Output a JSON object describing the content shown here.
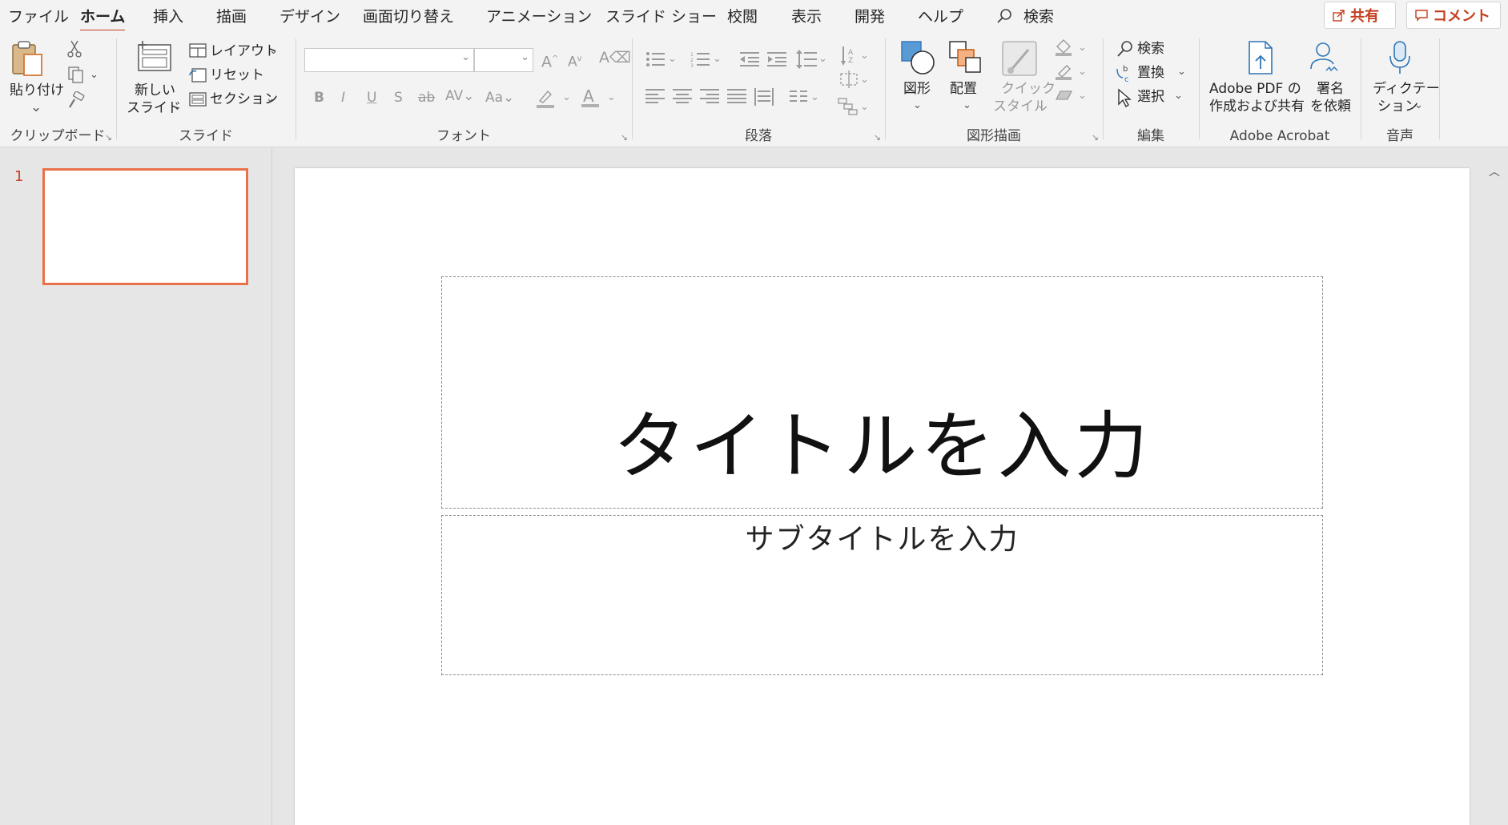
{
  "menu": {
    "tabs": [
      "ファイル",
      "ホーム",
      "挿入",
      "描画",
      "デザイン",
      "画面切り替え",
      "アニメーション",
      "スライド ショー",
      "校閲",
      "表示",
      "開発",
      "ヘルプ"
    ],
    "search": "検索",
    "share": "共有",
    "comment": "コメント"
  },
  "ribbon": {
    "clipboard": {
      "paste": "貼り付け",
      "label": "クリップボード"
    },
    "slides": {
      "new_slide_1": "新しい",
      "new_slide_2": "スライド",
      "layout": "レイアウト",
      "reset": "リセット",
      "section": "セクション",
      "label": "スライド"
    },
    "font": {
      "label": "フォント"
    },
    "paragraph": {
      "label": "段落"
    },
    "drawing": {
      "shapes": "図形",
      "arrange": "配置",
      "quick_style_1": "クイック",
      "quick_style_2": "スタイル",
      "label": "図形描画"
    },
    "editing": {
      "find": "検索",
      "replace": "置換",
      "select": "選択",
      "label": "編集"
    },
    "acrobat": {
      "create_share_1": "Adobe PDF の",
      "create_share_2": "作成および共有",
      "sign_1": "署名",
      "sign_2": "を依頼",
      "label": "Adobe Acrobat"
    },
    "voice": {
      "dictate_1": "ディクテー",
      "dictate_2": "ション",
      "label": "音声"
    }
  },
  "thumbnails": {
    "slide_number": "1"
  },
  "slide": {
    "title_placeholder": "タイトルを入力",
    "subtitle_placeholder": "サブタイトルを入力"
  },
  "colors": {
    "accent": "#c43e1c",
    "thumb_border": "#e9714a"
  }
}
